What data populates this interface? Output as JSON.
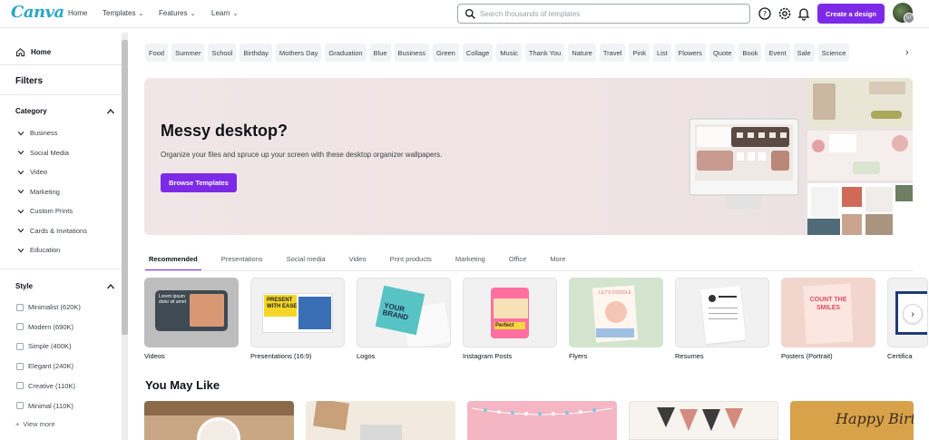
{
  "header": {
    "logo": "Canva",
    "nav": [
      {
        "label": "Home",
        "has_chevron": false
      },
      {
        "label": "Templates",
        "has_chevron": true
      },
      {
        "label": "Features",
        "has_chevron": true
      },
      {
        "label": "Learn",
        "has_chevron": true
      }
    ],
    "search_placeholder": "Search thousands of templates",
    "icons": [
      "help-icon",
      "settings-icon",
      "notifications-icon"
    ],
    "create_button": "Create a design",
    "avatar_initials": "ST"
  },
  "sidebar": {
    "home": "Home",
    "filters_title": "Filters",
    "category": {
      "title": "Category",
      "items": [
        "Business",
        "Social Media",
        "Video",
        "Marketing",
        "Custom Prints",
        "Cards & Invitations",
        "Education"
      ]
    },
    "style": {
      "title": "Style",
      "items": [
        "Minimalist (620K)",
        "Modern (690K)",
        "Simple (400K)",
        "Elegant (240K)",
        "Creative (110K)",
        "Minimal (110K)"
      ]
    },
    "view_more": "View more"
  },
  "chips": [
    "Food",
    "Summer",
    "School",
    "Birthday",
    "Mothers Day",
    "Graduation",
    "Blue",
    "Business",
    "Green",
    "Collage",
    "Music",
    "Thank You",
    "Nature",
    "Travel",
    "Pink",
    "List",
    "Flowers",
    "Quote",
    "Book",
    "Event",
    "Sale",
    "Science"
  ],
  "hero": {
    "title": "Messy desktop?",
    "subtitle": "Organize your files and spruce up your screen with these desktop organizer wallpapers.",
    "button": "Browse Templates"
  },
  "tabs": [
    "Recommended",
    "Presentations",
    "Social media",
    "Video",
    "Print products",
    "Marketing",
    "Office",
    "More"
  ],
  "active_tab": "Recommended",
  "categories": [
    {
      "label": "Videos",
      "thumb_text": "Lorem ipsum dolor sit amet"
    },
    {
      "label": "Presentations (16:9)",
      "thumb_text": "PRESENT WITH EASE"
    },
    {
      "label": "Logos",
      "thumb_text": "YOUR BRAND"
    },
    {
      "label": "Instagram Posts",
      "thumb_text": "Perfect"
    },
    {
      "label": "Flyers",
      "thumb_text": "LET'S DOODLE"
    },
    {
      "label": "Resumes",
      "thumb_text": ""
    },
    {
      "label": "Posters (Portrait)",
      "thumb_text": "COUNT THE SMILES"
    },
    {
      "label": "Certifica",
      "thumb_text": ""
    }
  ],
  "you_may_like": {
    "title": "You May Like",
    "card_text": "Happy Birth"
  },
  "colors": {
    "brand_purple": "#7d2ae8",
    "logo_teal": "#2aa6c8"
  }
}
